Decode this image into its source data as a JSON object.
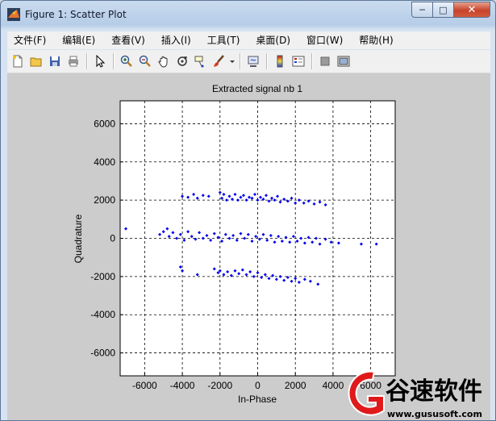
{
  "window": {
    "title": "Figure 1: Scatter Plot",
    "controls": {
      "minimize": "─",
      "maximize": "□",
      "close": "✕"
    }
  },
  "menu": [
    "文件(F)",
    "编辑(E)",
    "查看(V)",
    "插入(I)",
    "工具(T)",
    "桌面(D)",
    "窗口(W)",
    "帮助(H)"
  ],
  "toolbar": [
    {
      "icon": "new-file-icon"
    },
    {
      "icon": "open-folder-icon"
    },
    {
      "icon": "save-icon"
    },
    {
      "icon": "print-icon"
    },
    {
      "icon": "pointer-icon"
    },
    {
      "icon": "zoom-in-icon"
    },
    {
      "icon": "zoom-out-icon"
    },
    {
      "icon": "pan-hand-icon"
    },
    {
      "icon": "rotate-3d-icon"
    },
    {
      "icon": "data-cursor-icon"
    },
    {
      "icon": "brush-icon"
    },
    {
      "icon": "link-plot-icon"
    },
    {
      "icon": "colorbar-icon"
    },
    {
      "icon": "legend-icon"
    },
    {
      "icon": "hide-plot-tools-icon"
    },
    {
      "icon": "show-plot-tools-icon"
    }
  ],
  "chart_data": {
    "type": "scatter",
    "title": "Extracted signal nb 1",
    "xlabel": "In-Phase",
    "ylabel": "Quadrature",
    "xlim": [
      -7300,
      7300
    ],
    "ylim": [
      -7200,
      7200
    ],
    "xticks": [
      -6000,
      -4000,
      -2000,
      0,
      2000,
      4000,
      6000
    ],
    "yticks": [
      -6000,
      -4000,
      -2000,
      0,
      2000,
      4000,
      6000
    ],
    "grid": true,
    "marker_color": "#0000ee",
    "series": [
      {
        "points": [
          [
            -4000,
            2200
          ],
          [
            -3700,
            2150
          ],
          [
            -3400,
            2300
          ],
          [
            -3200,
            2100
          ],
          [
            -2900,
            2250
          ],
          [
            -2600,
            2200
          ],
          [
            -2000,
            2400
          ],
          [
            -1900,
            2100
          ],
          [
            -1800,
            2300
          ],
          [
            -1650,
            2000
          ],
          [
            -1500,
            2200
          ],
          [
            -1350,
            2050
          ],
          [
            -1200,
            2300
          ],
          [
            -1050,
            2000
          ],
          [
            -900,
            2150
          ],
          [
            -750,
            2250
          ],
          [
            -600,
            2000
          ],
          [
            -450,
            2150
          ],
          [
            -300,
            2100
          ],
          [
            -150,
            2300
          ],
          [
            0,
            2000
          ],
          [
            150,
            2150
          ],
          [
            300,
            2050
          ],
          [
            450,
            2250
          ],
          [
            600,
            1950
          ],
          [
            750,
            2100
          ],
          [
            900,
            2000
          ],
          [
            1050,
            2200
          ],
          [
            1200,
            1900
          ],
          [
            1400,
            2050
          ],
          [
            1600,
            1950
          ],
          [
            1800,
            2100
          ],
          [
            2000,
            1850
          ],
          [
            2200,
            2000
          ],
          [
            2450,
            1850
          ],
          [
            2700,
            1950
          ],
          [
            3000,
            1800
          ],
          [
            3300,
            1900
          ],
          [
            3600,
            1750
          ],
          [
            -7000,
            500
          ],
          [
            -5200,
            200
          ],
          [
            -5000,
            350
          ],
          [
            -4800,
            500
          ],
          [
            -4700,
            100
          ],
          [
            -4500,
            300
          ],
          [
            -4300,
            0
          ],
          [
            -4100,
            200
          ],
          [
            -3900,
            -100
          ],
          [
            -3700,
            350
          ],
          [
            -3500,
            100
          ],
          [
            -3300,
            -50
          ],
          [
            -3100,
            300
          ],
          [
            -2900,
            0
          ],
          [
            -2700,
            150
          ],
          [
            -2500,
            -100
          ],
          [
            -2300,
            250
          ],
          [
            -2100,
            50
          ],
          [
            -1900,
            -150
          ],
          [
            -1700,
            200
          ],
          [
            -1500,
            0
          ],
          [
            -1300,
            150
          ],
          [
            -1100,
            -100
          ],
          [
            -900,
            250
          ],
          [
            -700,
            0
          ],
          [
            -500,
            200
          ],
          [
            -300,
            -150
          ],
          [
            -100,
            100
          ],
          [
            100,
            -50
          ],
          [
            300,
            200
          ],
          [
            500,
            -100
          ],
          [
            700,
            150
          ],
          [
            900,
            -200
          ],
          [
            1100,
            100
          ],
          [
            1300,
            -150
          ],
          [
            1500,
            50
          ],
          [
            1700,
            -200
          ],
          [
            1900,
            100
          ],
          [
            2100,
            -150
          ],
          [
            2300,
            0
          ],
          [
            2500,
            -250
          ],
          [
            2700,
            50
          ],
          [
            2900,
            -200
          ],
          [
            3100,
            0
          ],
          [
            3300,
            -300
          ],
          [
            3600,
            -50
          ],
          [
            3900,
            -200
          ],
          [
            4300,
            -250
          ],
          [
            5500,
            -300
          ],
          [
            6300,
            -300
          ],
          [
            -4100,
            -1500
          ],
          [
            -4000,
            -1700
          ],
          [
            -3200,
            -1900
          ],
          [
            -2300,
            -1600
          ],
          [
            -2100,
            -1800
          ],
          [
            -2000,
            -1700
          ],
          [
            -1800,
            -1900
          ],
          [
            -1600,
            -1750
          ],
          [
            -1400,
            -1950
          ],
          [
            -1200,
            -1700
          ],
          [
            -1000,
            -1850
          ],
          [
            -800,
            -1650
          ],
          [
            -600,
            -1900
          ],
          [
            -400,
            -1750
          ],
          [
            -200,
            -2000
          ],
          [
            0,
            -1800
          ],
          [
            200,
            -2050
          ],
          [
            400,
            -1900
          ],
          [
            600,
            -2100
          ],
          [
            800,
            -1950
          ],
          [
            1000,
            -2150
          ],
          [
            1200,
            -2000
          ],
          [
            1400,
            -2200
          ],
          [
            1600,
            -2050
          ],
          [
            1800,
            -2250
          ],
          [
            2000,
            -2100
          ],
          [
            2200,
            -2300
          ],
          [
            2500,
            -2150
          ],
          [
            2800,
            -2250
          ],
          [
            3200,
            -2400
          ]
        ]
      }
    ]
  },
  "watermark": {
    "brand": "谷速软件",
    "url": "www.gususoft.com"
  }
}
